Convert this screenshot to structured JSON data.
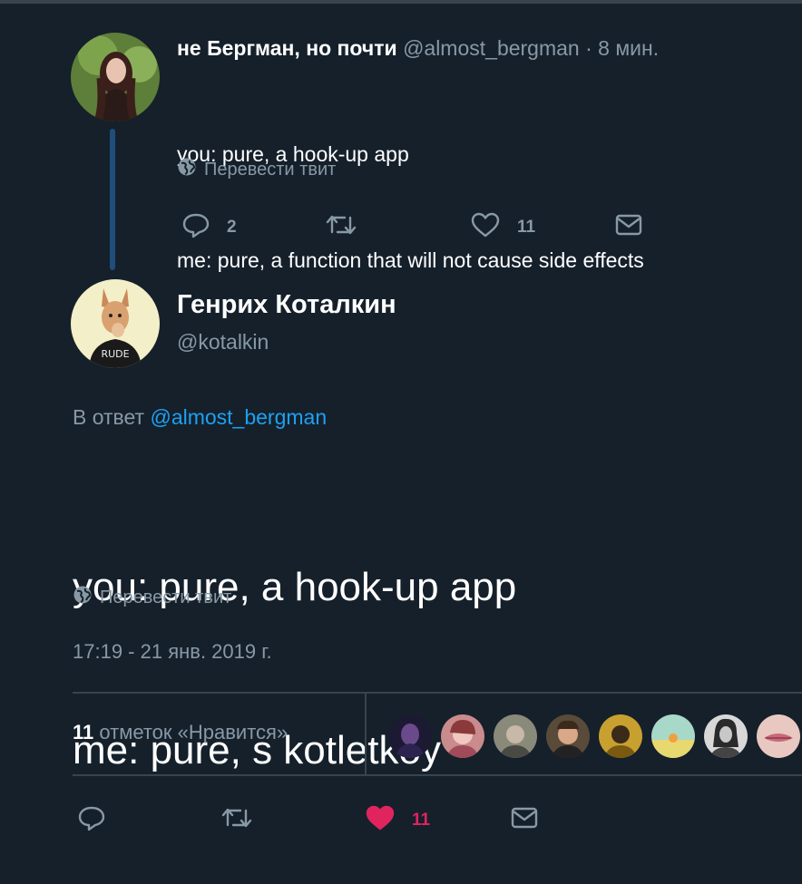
{
  "parent_tweet": {
    "author_name": "не Бергман, но почти",
    "author_handle": "@almost_bergman",
    "time_ago": "· 8 мин.",
    "lines": [
      "you: pure, a hook-up app",
      "me: pure, a function that will not cause side effects"
    ],
    "translate_label": "Перевести твит",
    "reply_count": "2",
    "like_count": "11"
  },
  "main_tweet": {
    "author_name": "Генрих Коталкин",
    "author_handle": "@kotalkin",
    "reply_prefix": "В ответ",
    "reply_to": "@almost_bergman",
    "lines": [
      "you: pure, a hook-up app",
      "me: pure, s kotletkoy"
    ],
    "translate_label": "Перевести твит",
    "timestamp": "17:19 - 21 янв. 2019 г.",
    "likes_number": "11",
    "likes_label": "отметок «Нравится»",
    "like_count": "11"
  },
  "icons": [
    "globe-icon",
    "reply-icon",
    "retweet-icon",
    "heart-icon",
    "dm-icon"
  ],
  "colors": {
    "background": "#15202b",
    "text_secondary": "#8899a6",
    "link": "#1da1f2",
    "liked": "#e0245e",
    "divider": "#38444d"
  }
}
